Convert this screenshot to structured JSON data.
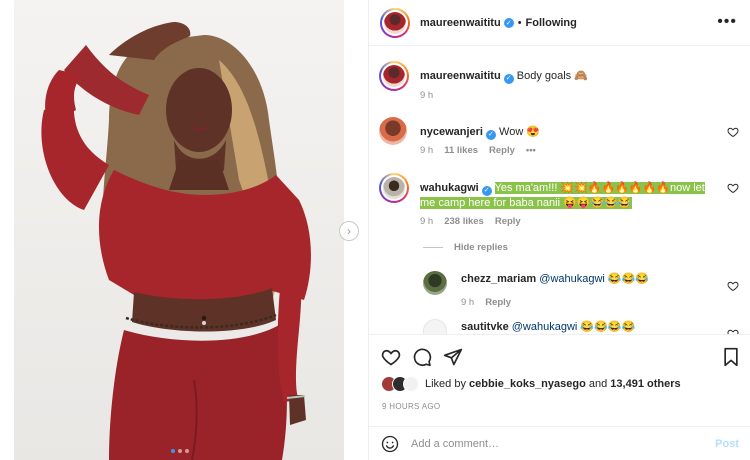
{
  "post": {
    "username": "maureenwaititu",
    "follow_separator": "•",
    "follow_label": "Following",
    "more_label": "•••",
    "caption": {
      "username": "maureenwaititu",
      "text": "Body goals 🙈",
      "time": "9 h"
    }
  },
  "comments": [
    {
      "username": "nycewanjeri",
      "text": "Wow 😍",
      "time": "9 h",
      "likes": "11 likes",
      "reply_label": "Reply",
      "more": "•••"
    },
    {
      "username": "wahukagwi",
      "text": "Yes ma'am!!! 💥💥🔥🔥🔥🔥🔥🔥now let me camp here for baba nanii 😝😝😂😂😂",
      "time": "9 h",
      "likes": "238 likes",
      "reply_label": "Reply"
    }
  ],
  "hide_replies_label": "Hide replies",
  "replies": [
    {
      "username": "chezz_mariam",
      "mention": "@wahukagwi",
      "text": " 😂😂😂",
      "time": "9 h",
      "reply_label": "Reply"
    },
    {
      "username": "sautitvke",
      "mention": "@wahukagwi",
      "text": " 😂😂😂😂"
    }
  ],
  "likes": {
    "prefix": "Liked by ",
    "user": "cebbie_koks_nyasego",
    "middle": " and ",
    "count": "13,491 others"
  },
  "time_ago": "9 HOURS AGO",
  "add_comment": {
    "placeholder": "Add a comment…",
    "post_label": "Post"
  },
  "colors": {
    "accent": "#3897f0",
    "highlight": "#8bc34a",
    "outfit": "#a6262c"
  }
}
